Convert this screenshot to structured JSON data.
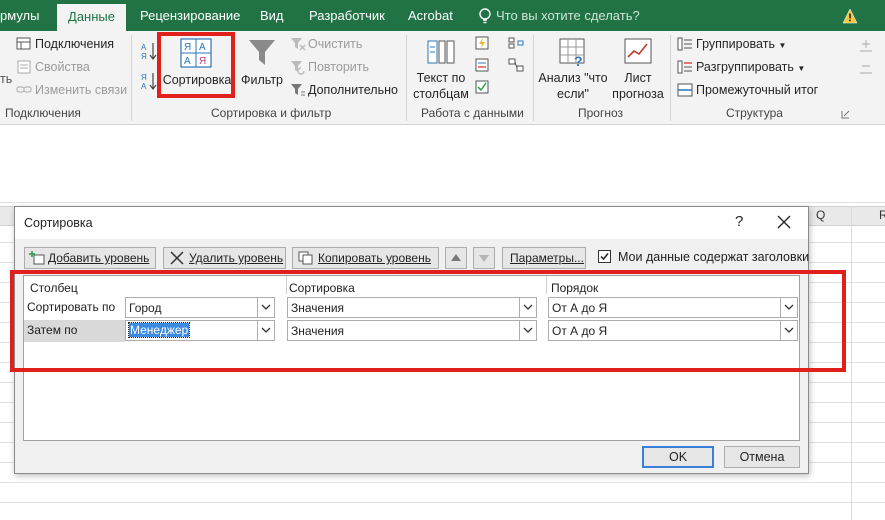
{
  "ribbon": {
    "tabs": [
      {
        "label": "рмулы"
      },
      {
        "label": "Данные"
      },
      {
        "label": "Рецензирование"
      },
      {
        "label": "Вид"
      },
      {
        "label": "Разработчик"
      },
      {
        "label": "Acrobat"
      }
    ],
    "tell_me": "Что вы хотите сделать?",
    "connections": {
      "group_label": "Подключения",
      "items": [
        "Подключения",
        "Свойства",
        "Изменить связи"
      ],
      "cut_label": "ть"
    },
    "sort_filter": {
      "group_label": "Сортировка и фильтр",
      "sort_label": "Сортировка",
      "filter_label": "Фильтр",
      "clear_label": "Очистить",
      "reapply_label": "Повторить",
      "advanced_label": "Дополнительно"
    },
    "data_tools": {
      "group_label": "Работа с данными",
      "text_to_columns": [
        "Текст по",
        "столбцам"
      ]
    },
    "forecast": {
      "group_label": "Прогноз",
      "what_if": [
        "Анализ \"что",
        "если\""
      ],
      "forecast_sheet": [
        "Лист",
        "прогноза"
      ]
    },
    "outline": {
      "group_label": "Структура",
      "group_btn": "Группировать",
      "ungroup_btn": "Разгруппировать",
      "subtotal_btn": "Промежуточный итог"
    }
  },
  "sheet": {
    "column_headers": [
      "Q",
      "R"
    ]
  },
  "dialog": {
    "title": "Сортировка",
    "help": "?",
    "toolbar": {
      "add_level": "Добавить уровень",
      "delete_level": "Удалить уровень",
      "copy_level": "Копировать уровень",
      "options": "Параметры..."
    },
    "has_headers_label": "Мои данные содержат заголовки",
    "has_headers_checked": true,
    "headers": {
      "column": "Столбец",
      "sort_on": "Сортировка",
      "order": "Порядок"
    },
    "rows": [
      {
        "label": "Сортировать по",
        "column": "Город",
        "sort_on": "Значения",
        "order": "От А до Я"
      },
      {
        "label": "Затем по",
        "column": "Менеджер",
        "sort_on": "Значения",
        "order": "От А до Я"
      }
    ],
    "ok_label": "OK",
    "cancel_label": "Отмена"
  },
  "colors": {
    "ribbon_green": "#217346",
    "highlight_red": "#e0201b",
    "selection_blue": "#3c8be0"
  }
}
